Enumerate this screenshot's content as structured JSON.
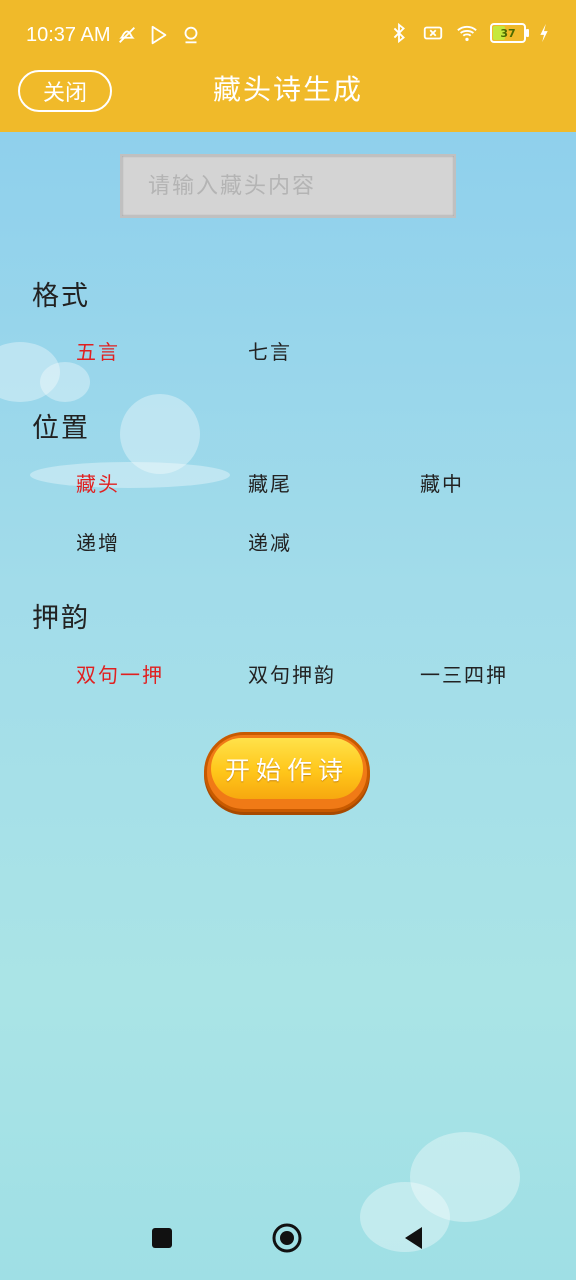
{
  "status_bar": {
    "time": "10:37 AM",
    "battery": "37",
    "icons_left": [
      "mute-icon",
      "play-store-icon",
      "location-icon"
    ],
    "icons_right": [
      "bluetooth-icon",
      "sim-off-icon",
      "wifi-icon",
      "battery-icon",
      "charging-icon"
    ]
  },
  "app_bar": {
    "close_label": "关闭",
    "title": "藏头诗生成"
  },
  "input": {
    "placeholder": "请输入藏头内容",
    "value": ""
  },
  "sections": {
    "format": {
      "label": "格式",
      "options": [
        "五言",
        "七言"
      ],
      "selected": "五言"
    },
    "position": {
      "label": "位置",
      "options": [
        "藏头",
        "藏尾",
        "藏中",
        "递增",
        "递减"
      ],
      "selected": "藏头"
    },
    "rhyme": {
      "label": "押韵",
      "options": [
        "双句一押",
        "双句押韵",
        "一三四押"
      ],
      "selected": "双句一押"
    }
  },
  "start_button": {
    "label": "开始作诗"
  },
  "colors": {
    "accent": "#f0ba2a",
    "selected": "#e02020",
    "button": "#ffc61a"
  },
  "nav_bar": {
    "icons": [
      "recents-square-icon",
      "home-circle-icon",
      "back-triangle-icon"
    ]
  }
}
